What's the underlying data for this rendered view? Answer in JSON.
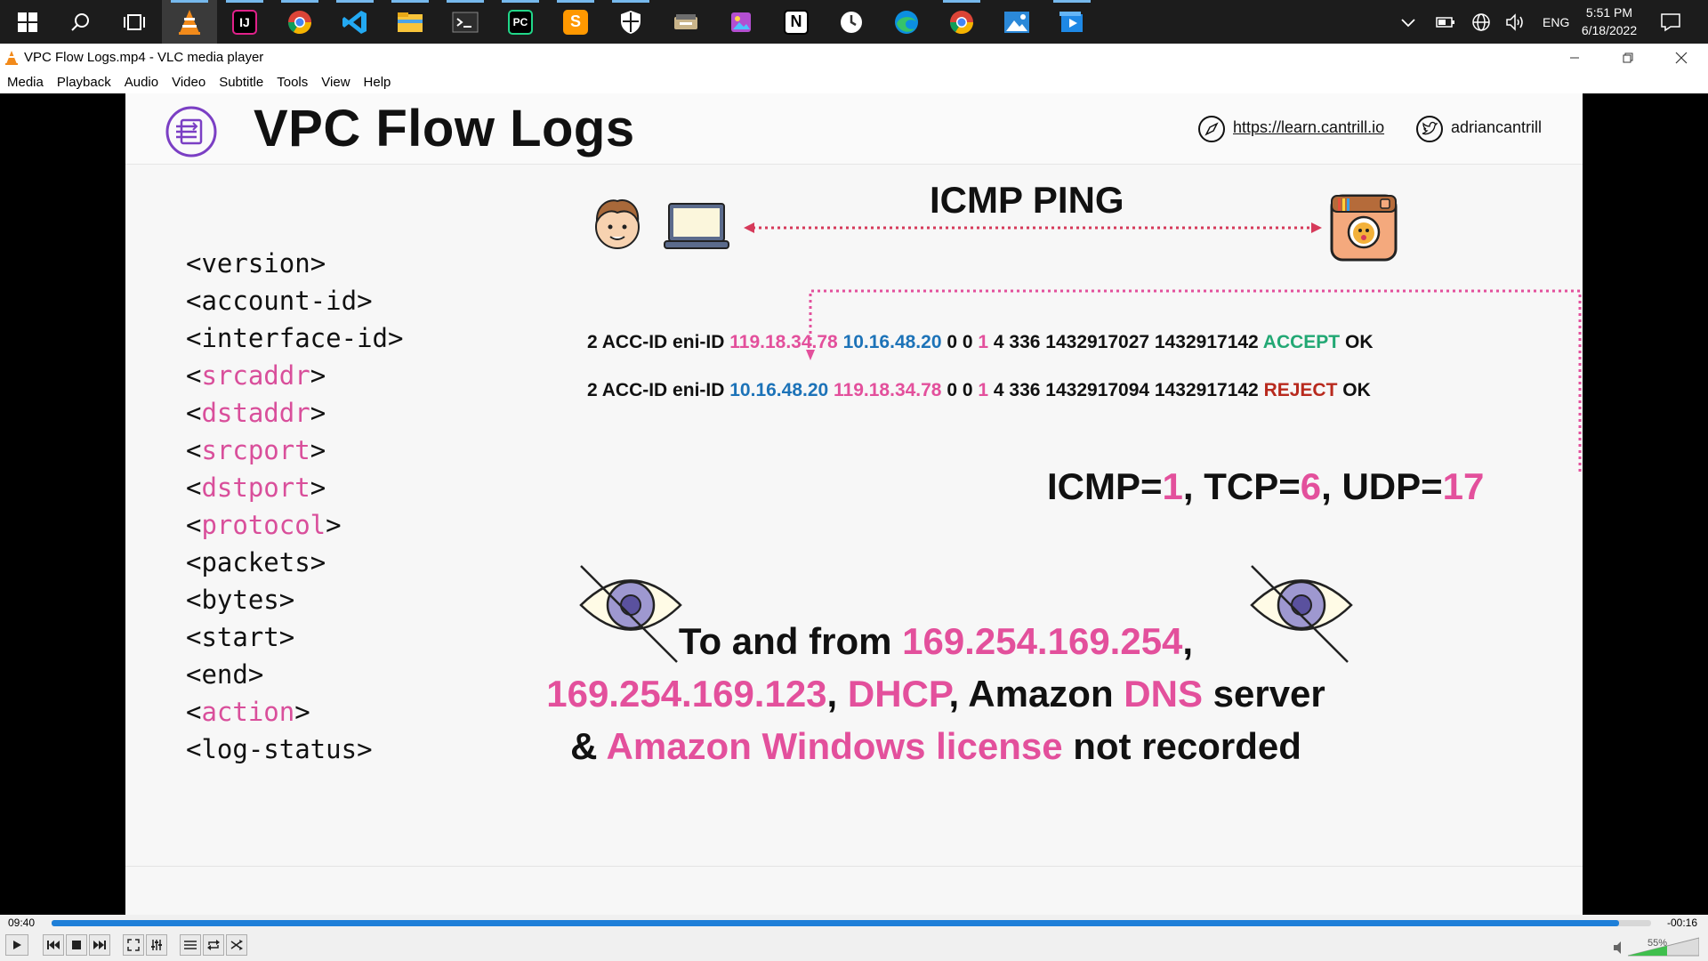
{
  "taskbar": {
    "tray": {
      "language": "ENG",
      "time": "5:51 PM",
      "date": "6/18/2022"
    }
  },
  "window": {
    "title": "VPC Flow Logs.mp4 - VLC media player",
    "menu": [
      "Media",
      "Playback",
      "Audio",
      "Video",
      "Subtitle",
      "Tools",
      "View",
      "Help"
    ]
  },
  "slide": {
    "title": "VPC Flow Logs",
    "website": "https://learn.cantrill.io",
    "twitter": "adriancantrill",
    "fields": [
      {
        "open": "<",
        "name": "version",
        "close": ">",
        "highlight": false
      },
      {
        "open": "<",
        "name": "account-id",
        "close": ">",
        "highlight": false
      },
      {
        "open": "<",
        "name": "interface-id",
        "close": ">",
        "highlight": false
      },
      {
        "open": "<",
        "name": "srcaddr",
        "close": ">",
        "highlight": true
      },
      {
        "open": "<",
        "name": "dstaddr",
        "close": ">",
        "highlight": true
      },
      {
        "open": "<",
        "name": "srcport",
        "close": ">",
        "highlight": true
      },
      {
        "open": "<",
        "name": "dstport",
        "close": ">",
        "highlight": true
      },
      {
        "open": "<",
        "name": "protocol",
        "close": ">",
        "highlight": true
      },
      {
        "open": "<",
        "name": "packets",
        "close": ">",
        "highlight": false
      },
      {
        "open": "<",
        "name": "bytes",
        "close": ">",
        "highlight": false
      },
      {
        "open": "<",
        "name": "start",
        "close": ">",
        "highlight": false
      },
      {
        "open": "<",
        "name": "end",
        "close": ">",
        "highlight": false
      },
      {
        "open": "<",
        "name": "action",
        "close": ">",
        "highlight": true
      },
      {
        "open": "<",
        "name": "log-status",
        "close": ">",
        "highlight": false
      }
    ],
    "ping_label": "ICMP PING",
    "log_lines": [
      {
        "prefix": "2 ACC-ID eni-ID",
        "src": "119.18.34.78",
        "dst": "10.16.48.20",
        "ports": "0 0",
        "protocol": "1",
        "rest": "4 336 1432917027 1432917142",
        "action": "ACCEPT",
        "status": "OK"
      },
      {
        "prefix": "2 ACC-ID eni-ID",
        "src": "10.16.48.20",
        "dst": "119.18.34.78",
        "ports": "0 0",
        "protocol": "1",
        "rest": "4 336 1432917094 1432917142",
        "action": "REJECT",
        "status": "OK"
      }
    ],
    "protocols": {
      "icmp_label": "ICMP=",
      "icmp_value": "1",
      "tcp_label": ", TCP=",
      "tcp_value": "6",
      "udp_label": ", UDP=",
      "udp_value": "17"
    },
    "note": {
      "l1_a": "To and from ",
      "l1_b": "169.254.169.254",
      "l1_c": ",",
      "l2_a": "169.254.169.123",
      "l2_b": ", ",
      "l2_c": "DHCP",
      "l2_d": ", Amazon ",
      "l2_e": "DNS",
      "l2_f": " server",
      "l3_a": "& ",
      "l3_b": "Amazon Windows license",
      "l3_c": " not recorded"
    }
  },
  "player": {
    "elapsed": "09:40",
    "remaining": "-00:16",
    "progress": 0.98,
    "volume_label": "55%",
    "volume": 0.55
  },
  "colors": {
    "accent_pink": "#e3509c",
    "ip_blue": "#1d73b8",
    "accept_green": "#22a874",
    "reject_red": "#b82a1e",
    "seek_blue": "#1e7fd8"
  }
}
